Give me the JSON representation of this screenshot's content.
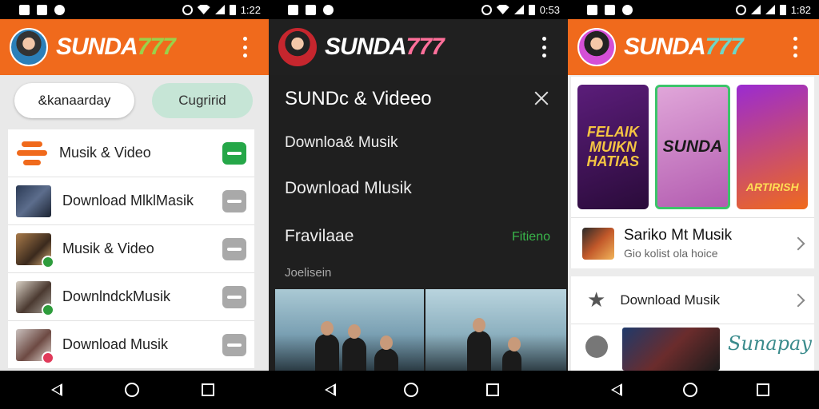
{
  "status": {
    "screen1_time": "1:22",
    "screen2_time": "0:53",
    "screen3_time": "1:82"
  },
  "brand": {
    "name": "SUNDA",
    "number": "777"
  },
  "screen1": {
    "chips": [
      "&kanaarday",
      "Cugririd"
    ],
    "items": [
      {
        "label": "Musik & Video",
        "toggle": "on"
      },
      {
        "label": "Download MlklMasik",
        "toggle": "off"
      },
      {
        "label": "Musik & Video",
        "toggle": "off"
      },
      {
        "label": "DownlndckMusik",
        "toggle": "off"
      },
      {
        "label": "Download Musik",
        "toggle": "off"
      }
    ]
  },
  "screen2": {
    "drawer_title": "SUNDc & Videeo",
    "items": [
      "Downloa& Musik",
      "Download Mlusik",
      "Fravilaae"
    ],
    "item_right": "Fitieno",
    "subheading": "Joelisein"
  },
  "screen3": {
    "posters": [
      "FELAIK MUIKN HATIAS",
      "SUNDA",
      "ARTIRISH"
    ],
    "featured": {
      "title": "Sariko Mt Musik",
      "subtitle": "Gio kolist ola hoice"
    },
    "section_label": "Download Musik",
    "album_text": "Sunapay"
  },
  "colors": {
    "accent_orange": "#f06a1c",
    "toggle_on": "#25a748",
    "dark_bg": "#202020"
  }
}
